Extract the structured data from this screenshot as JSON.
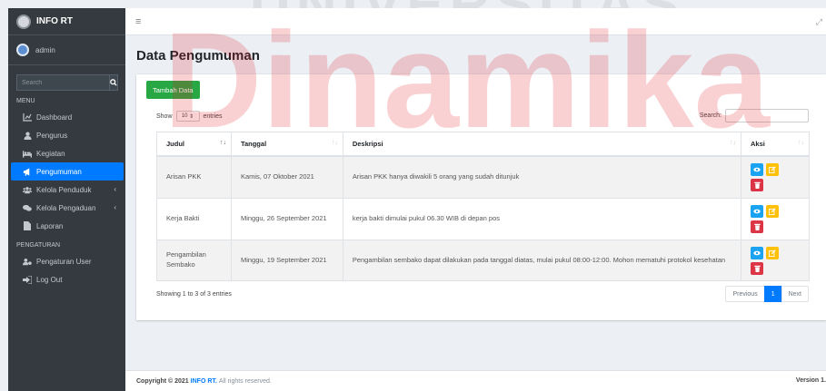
{
  "brand": {
    "title": "INFO RT"
  },
  "user": {
    "name": "admin"
  },
  "sidebar": {
    "search_placeholder": "Search",
    "menu_header": "MENU",
    "settings_header": "PENGATURAN",
    "items": [
      {
        "label": "Dashboard",
        "icon": "chart-icon"
      },
      {
        "label": "Pengurus",
        "icon": "user-icon"
      },
      {
        "label": "Kegiatan",
        "icon": "bed-icon"
      },
      {
        "label": "Pengumuman",
        "icon": "bullhorn-icon",
        "active": true
      },
      {
        "label": "Kelola Penduduk",
        "icon": "users-icon"
      },
      {
        "label": "Kelola Pengaduan",
        "icon": "comments-icon"
      },
      {
        "label": "Laporan",
        "icon": "file-icon"
      }
    ],
    "settings_items": [
      {
        "label": "Pengaturan User",
        "icon": "users-cog-icon"
      },
      {
        "label": "Log Out",
        "icon": "logout-icon"
      }
    ]
  },
  "watermark": {
    "top": "UNIVERSITAS",
    "main": "Dinamika"
  },
  "page": {
    "title": "Data Pengumuman",
    "add_button": "Tambah Data",
    "show_label": "Show",
    "entries_value": "10",
    "entries_label": "entries",
    "search_label": "Search:"
  },
  "table": {
    "headers": [
      "Judul",
      "Tanggal",
      "Deskripsi",
      "Aksi"
    ],
    "rows": [
      {
        "judul": "Arisan PKK",
        "tanggal": "Kamis, 07 Oktober 2021",
        "deskripsi": "Arisan PKK hanya diwakili 5 orang yang sudah ditunjuk"
      },
      {
        "judul": "Kerja Bakti",
        "tanggal": "Minggu, 26 September 2021",
        "deskripsi": "kerja bakti dimulai pukul 06.30 WIB di depan pos"
      },
      {
        "judul": "Pengambilan Sembako",
        "tanggal": "Minggu, 19 September 2021",
        "deskripsi": "Pengambilan sembako dapat dilakukan pada tanggal diatas, mulai pukul 08:00-12:00. Mohon mematuhi protokol kesehatan"
      }
    ]
  },
  "pagination": {
    "info": "Showing 1 to 3 of 3 entries",
    "previous": "Previous",
    "current": "1",
    "next": "Next"
  },
  "footer": {
    "copyright_prefix": "Copyright © 2021",
    "brand": "INFO RT.",
    "suffix": "All rights reserved.",
    "version": "Version 1."
  },
  "colors": {
    "primary": "#007bff",
    "success": "#28a745",
    "sidebar": "#343a40",
    "danger": "#dc3545",
    "warning": "#ffc107",
    "watermark": "#e31b23"
  }
}
